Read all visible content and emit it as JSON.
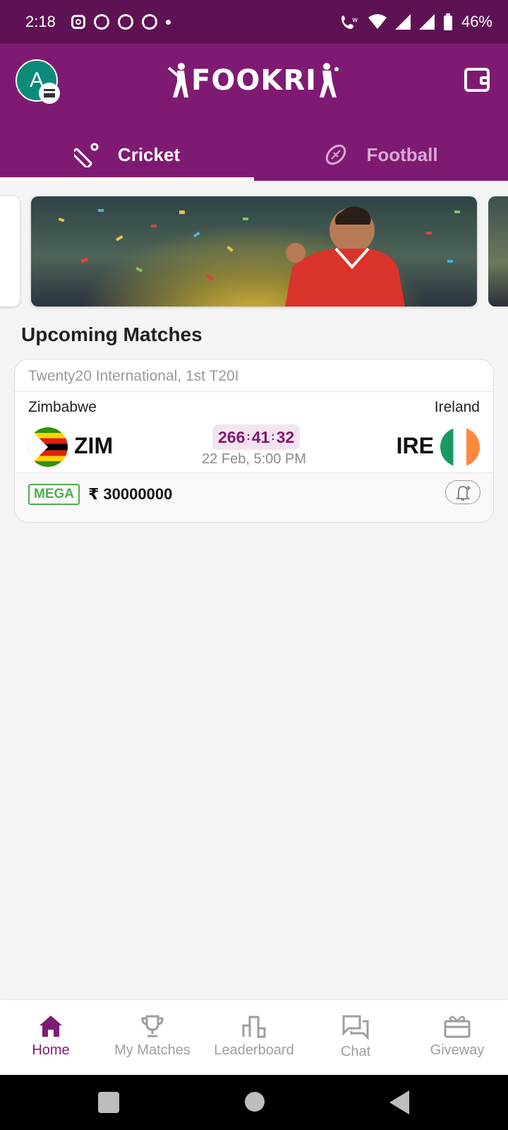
{
  "status_bar": {
    "time": "2:18",
    "battery": "46%",
    "icons": [
      "instagram-icon",
      "app-notification-icon",
      "app-notification-icon",
      "app-notification-icon",
      "more-notifications-dot",
      "wifi-calling-icon",
      "wifi-icon",
      "signal-icon",
      "signal-icon",
      "battery-icon"
    ]
  },
  "header": {
    "avatar_letter": "A",
    "logo_text": "FOOKRI",
    "brand_color": "#7f1a73"
  },
  "tabs": [
    {
      "label": "Cricket",
      "icon": "cricket-icon",
      "active": true
    },
    {
      "label": "Football",
      "icon": "football-icon",
      "active": false
    }
  ],
  "section_title": "Upcoming Matches",
  "match": {
    "series": "Twenty20 International, 1st T20I",
    "team1": {
      "name": "Zimbabwe",
      "code": "ZIM"
    },
    "team2": {
      "name": "Ireland",
      "code": "IRE"
    },
    "countdown": {
      "hours": "266",
      "minutes": "41",
      "seconds": "32"
    },
    "start_time": "22 Feb, 5:00 PM",
    "contest_badge": "MEGA",
    "prize": "₹ 30000000"
  },
  "bottom_nav": [
    {
      "label": "Home",
      "icon": "home-icon",
      "active": true
    },
    {
      "label": "My Matches",
      "icon": "trophy-icon",
      "active": false
    },
    {
      "label": "Leaderboard",
      "icon": "leaderboard-icon",
      "active": false
    },
    {
      "label": "Chat",
      "icon": "chat-icon",
      "active": false
    },
    {
      "label": "Giveway",
      "icon": "gift-icon",
      "active": false
    }
  ]
}
